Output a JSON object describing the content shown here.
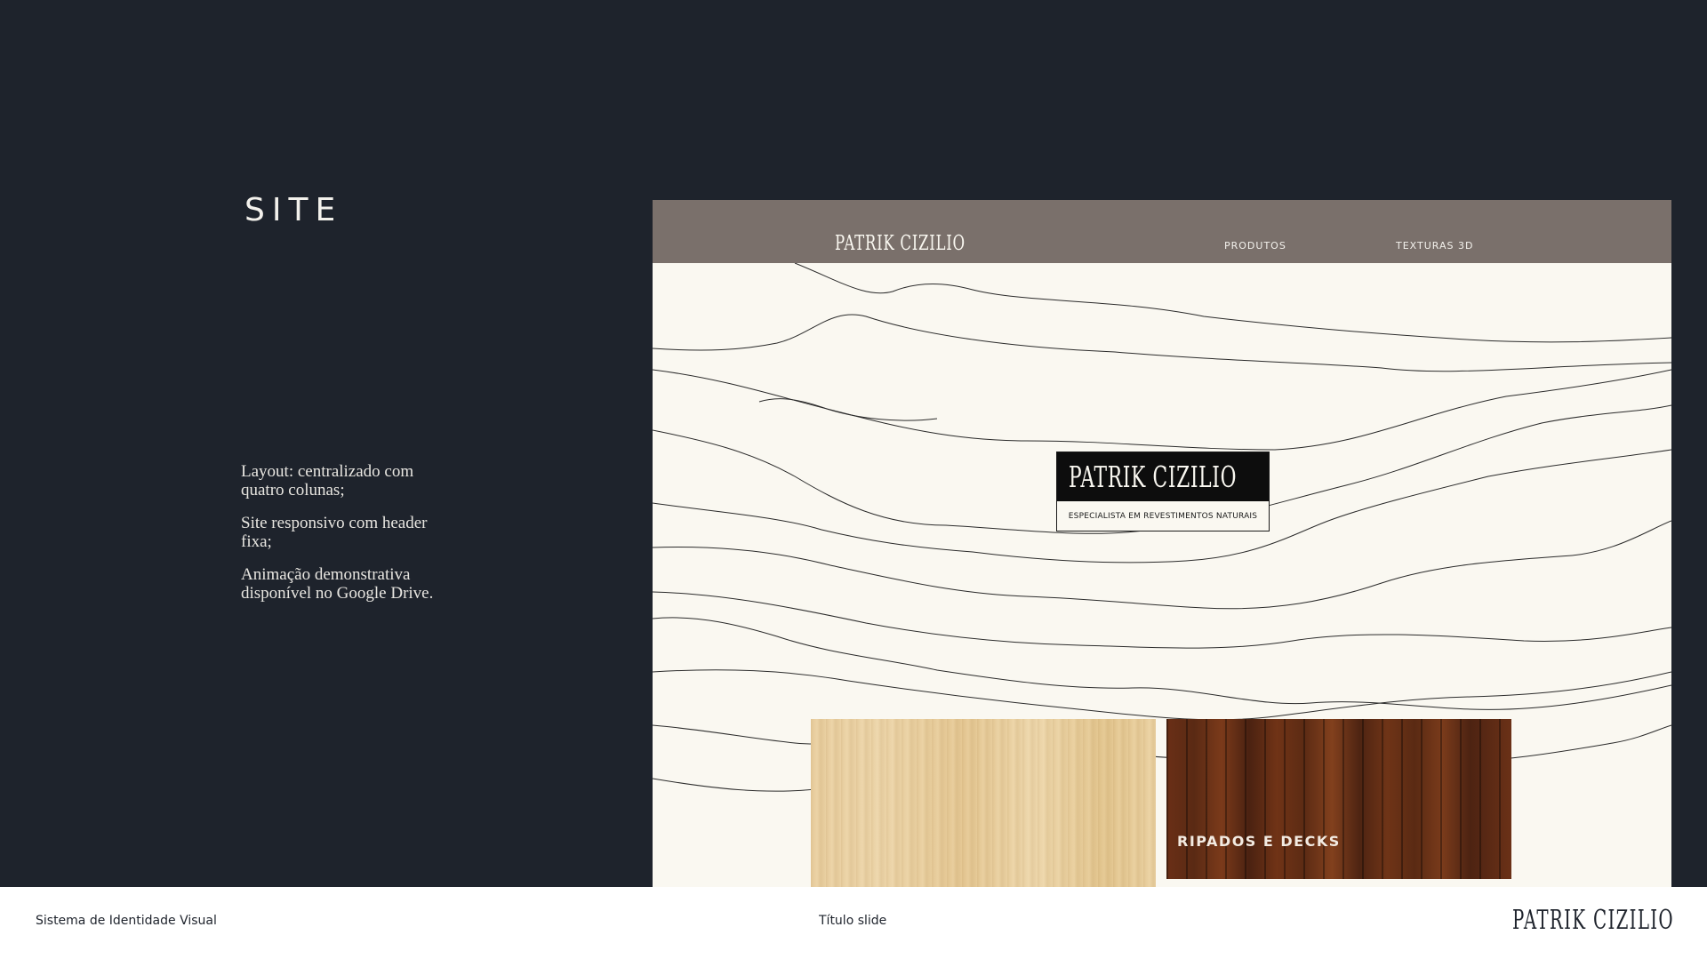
{
  "slide": {
    "title": "SITE",
    "notes": [
      "Layout: centralizado com quatro colunas;",
      "Site responsivo com header fixa;",
      "Animação demonstrativa disponível no Google Drive."
    ]
  },
  "mockup": {
    "header": {
      "logo": "PATRIK CIZILIO",
      "nav": [
        "PRODUTOS",
        "TEXTURAS 3D"
      ]
    },
    "hero": {
      "name": "PATRIK CIZILIO",
      "tagline": "ESPECIALISTA EM REVESTIMENTOS NATURAIS"
    },
    "cards": [
      {
        "label": ""
      },
      {
        "label": "RIPADOS E DECKS"
      }
    ]
  },
  "footer": {
    "left": "Sistema de Identidade Visual",
    "middle": "Título slide",
    "logo": "PATRIK CIZILIO"
  },
  "colors": {
    "background": "#1e232c",
    "header": "#7a706b",
    "canvas": "#faf8f1"
  }
}
